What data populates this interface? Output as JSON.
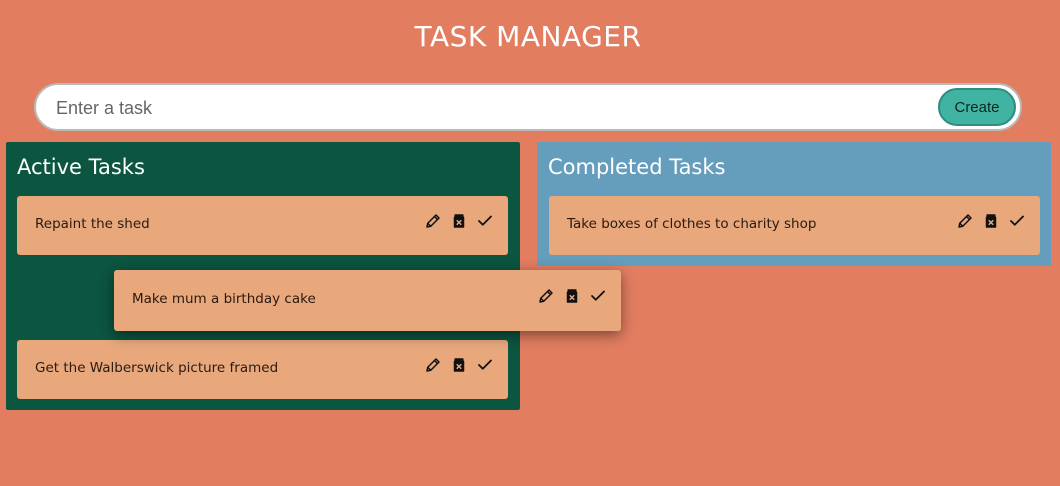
{
  "header": {
    "title": "TASK MANAGER"
  },
  "form": {
    "placeholder": "Enter a task",
    "value": "",
    "create_label": "Create"
  },
  "active": {
    "heading": "Active Tasks",
    "tasks": [
      {
        "text": "Repaint the shed"
      },
      {
        "text": "Make mum a birthday cake"
      },
      {
        "text": "Get the Walberswick picture framed"
      }
    ]
  },
  "completed": {
    "heading": "Completed Tasks",
    "tasks": [
      {
        "text": "Take boxes of clothes to charity shop"
      }
    ]
  },
  "icons": {
    "edit": "pencil-icon",
    "delete": "trash-icon",
    "complete": "check-icon"
  },
  "colors": {
    "background": "#e27d60",
    "active_panel": "#0b5541",
    "completed_panel": "#659dbd",
    "task_card": "#e8a87c",
    "create_button": "#41b3a3"
  }
}
